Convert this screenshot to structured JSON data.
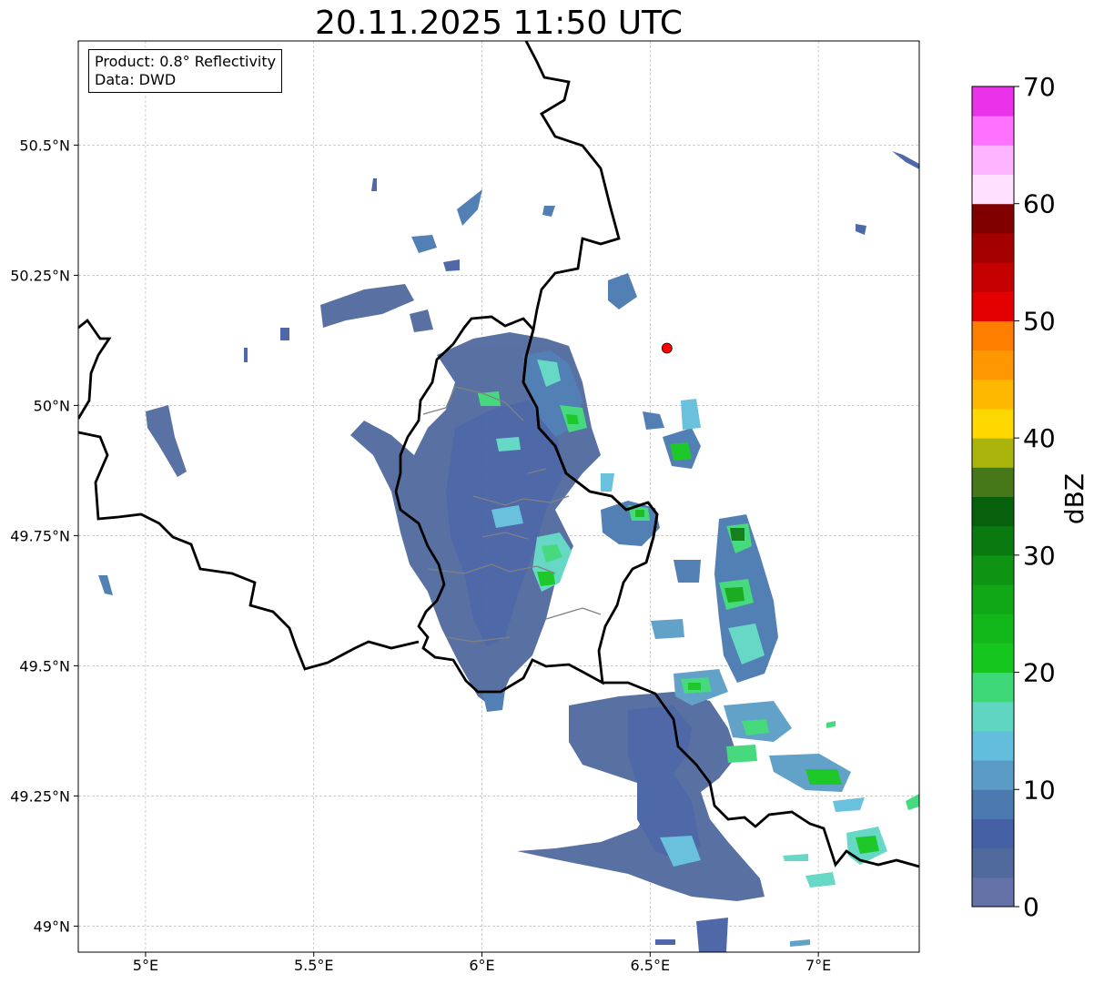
{
  "title": "20.11.2025 11:50 UTC",
  "info_box": {
    "product_line": "Product: 0.8° Reflectivity",
    "data_line": "Data: DWD"
  },
  "map": {
    "lon_range": [
      4.8,
      7.3
    ],
    "lat_range": [
      48.95,
      50.7
    ],
    "lon_ticks": [
      {
        "value": 5.0,
        "label": "5°E"
      },
      {
        "value": 5.5,
        "label": "5.5°E"
      },
      {
        "value": 6.0,
        "label": "6°E"
      },
      {
        "value": 6.5,
        "label": "6.5°E"
      },
      {
        "value": 7.0,
        "label": "7°E"
      }
    ],
    "lat_ticks": [
      {
        "value": 49.0,
        "label": "49°N"
      },
      {
        "value": 49.25,
        "label": "49.25°N"
      },
      {
        "value": 49.5,
        "label": "49.5°N"
      },
      {
        "value": 49.75,
        "label": "49.75°N"
      },
      {
        "value": 50.0,
        "label": "50°N"
      },
      {
        "value": 50.25,
        "label": "50.25°N"
      },
      {
        "value": 50.5,
        "label": "50.5°N"
      }
    ],
    "gridlines": true,
    "radar_site": {
      "lon": 6.55,
      "lat": 50.11,
      "color": "#ff0000"
    }
  },
  "colorbar": {
    "unit": "dBZ",
    "range": [
      0,
      70
    ],
    "tick_values": [
      0,
      10,
      20,
      30,
      40,
      50,
      60,
      70
    ],
    "tick_labels": [
      "0",
      "10",
      "20",
      "30",
      "40",
      "50",
      "60",
      "70"
    ],
    "colors": [
      "#6472a8",
      "#506a9e",
      "#4560a4",
      "#4a7ab0",
      "#5a9cc6",
      "#62bedc",
      "#5ed6c2",
      "#3ed878",
      "#14c61e",
      "#12b81a",
      "#10a816",
      "#0e9412",
      "#0a7a10",
      "#06600c",
      "#46781a",
      "#aab40a",
      "#ffd800",
      "#ffb800",
      "#ff9800",
      "#ff7e00",
      "#e40000",
      "#c40000",
      "#a40000",
      "#800000",
      "#ffe0ff",
      "#ffb4ff",
      "#ff72ff",
      "#ea32ea"
    ]
  }
}
